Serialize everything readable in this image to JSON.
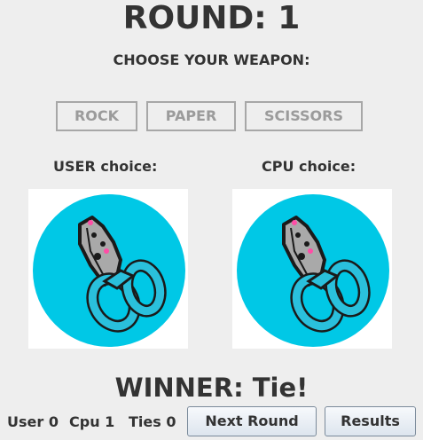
{
  "round": {
    "title": "ROUND: 1"
  },
  "prompt": "CHOOSE YOUR WEAPON:",
  "weapons": [
    {
      "label": "ROCK"
    },
    {
      "label": "PAPER"
    },
    {
      "label": "SCISSORS"
    }
  ],
  "user": {
    "label": "USER choice:",
    "choice_icon": "scissors-icon"
  },
  "cpu": {
    "label": "CPU choice:",
    "choice_icon": "scissors-icon"
  },
  "result": {
    "text": "WINNER: Tie!"
  },
  "score": {
    "user": "User 0",
    "cpu": "Cpu 1",
    "ties": "Ties 0"
  },
  "actions": {
    "next_label": "Next Round",
    "results_label": "Results"
  },
  "colors": {
    "circle": "#00c8e6",
    "handle": "#2ac0dc",
    "blade": "#a9a9a9",
    "outline": "#1a1a1a",
    "accent": "#ff4da6"
  }
}
